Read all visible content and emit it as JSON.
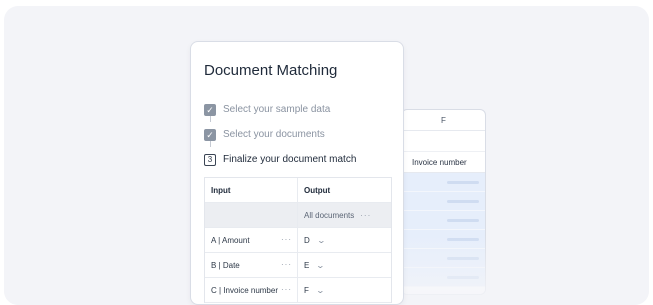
{
  "spreadsheet": {
    "column_letter": "F",
    "column_title": "Invoice number"
  },
  "card": {
    "title": "Document Matching",
    "steps": [
      {
        "label": "Select your sample data",
        "state": "done"
      },
      {
        "label": "Select your documents",
        "state": "done"
      },
      {
        "label": "Finalize your document match",
        "state": "active",
        "number": "3"
      }
    ]
  },
  "table": {
    "headers": {
      "input": "Input",
      "output": "Output"
    },
    "all_documents_label": "All documents",
    "more_glyph": "···",
    "rows": [
      {
        "input": "A | Amount",
        "output": "D"
      },
      {
        "input": "B | Date",
        "output": "E"
      },
      {
        "input": "C | Invoice number",
        "output": "F"
      }
    ]
  },
  "icons": {
    "check": "check-icon",
    "more": "more-horizontal-icon",
    "dropdown": "chevron-down-icon"
  },
  "colors": {
    "background": "#f3f4f8",
    "highlight": "#e6eefb",
    "check": "#8b95a3"
  }
}
